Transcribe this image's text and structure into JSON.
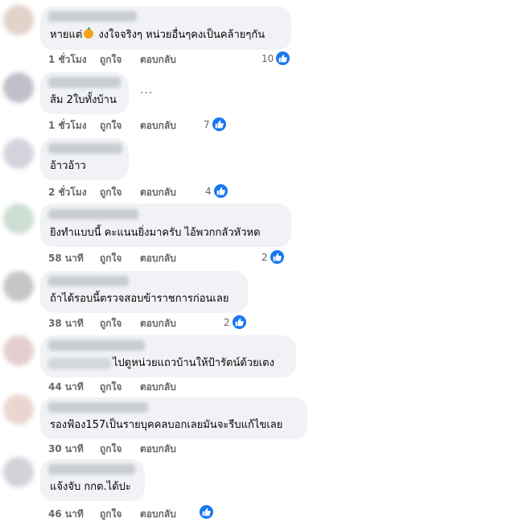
{
  "comments": [
    {
      "text_a": "หายแต่",
      "text_b": " งงใจจริงๆ หน่วยอื่นๆคงเป็นคล้ายๆกัน",
      "time": "1 ชั่วโมง",
      "like": "ถูกใจ",
      "reply": "ตอบกลับ",
      "reactions": "10"
    },
    {
      "text": "ส้ม 2ใบทั้งบ้าน",
      "time": "1 ชั่วโมง",
      "like": "ถูกใจ",
      "reply": "ตอบกลับ",
      "reactions": "7",
      "more": "..."
    },
    {
      "text": "อ้าวอ้าว",
      "time": "2 ชั่วโมง",
      "like": "ถูกใจ",
      "reply": "ตอบกลับ",
      "reactions": "4"
    },
    {
      "text": "ยิงทำแบบนี้ คะแนนยิ่งมาครับ ไอ้พวกกลัวหัวหด",
      "time": "58 นาที",
      "like": "ถูกใจ",
      "reply": "ตอบกลับ",
      "reactions": "2"
    },
    {
      "text": "ถ้าได้รอบนี้ตรวจสอบข้าราชการก่อนเลย",
      "time": "38 นาที",
      "like": "ถูกใจ",
      "reply": "ตอบกลับ",
      "reactions": "2"
    },
    {
      "text": "ไปดูหน่วยแถวบ้านให้ป้ารัตน์ด้วยเตง",
      "time": "44 นาที",
      "like": "ถูกใจ",
      "reply": "ตอบกลับ"
    },
    {
      "text": "รองฟ้อง157เป็นรายบุคคลบอกเลยมันจะรีบแก้ไขเลย",
      "time": "30 นาที",
      "like": "ถูกใจ",
      "reply": "ตอบกลับ"
    },
    {
      "text": "แจ้งจับ กกต.ได้ปะ",
      "time": "46 นาที",
      "like": "ถูกใจ",
      "reply": "ตอบกลับ",
      "reactions": ""
    }
  ],
  "colors": {
    "bubble": "#f0f2f5",
    "meta": "#65676b",
    "like_blue": "#1877f2"
  },
  "icons": {
    "reaction": "like-thumb-icon",
    "emoji": "orange-emoji-icon"
  }
}
